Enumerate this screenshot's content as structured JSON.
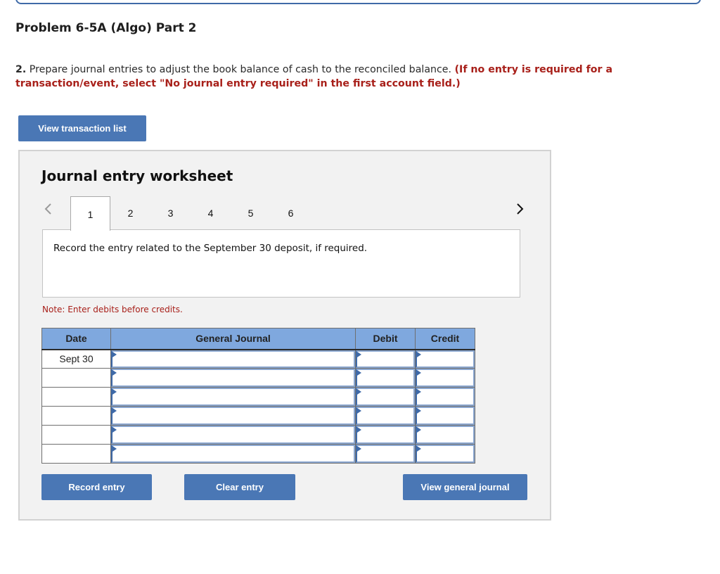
{
  "header": {
    "problem_title": "Problem 6-5A (Algo) Part 2",
    "instruction_number": "2.",
    "instruction_text": " Prepare journal entries to adjust the book balance of cash to the reconciled balance. ",
    "instruction_warning": "(If no entry is required for a transaction/event, select \"No journal entry required\" in the first account field.)"
  },
  "buttons": {
    "view_transaction_list": "View transaction list",
    "record_entry": "Record entry",
    "clear_entry": "Clear entry",
    "view_general_journal": "View general journal"
  },
  "worksheet": {
    "title": "Journal entry worksheet",
    "nav": {
      "prev_icon": "chevron-left-icon",
      "next_icon": "chevron-right-icon"
    },
    "tabs": [
      {
        "label": "1",
        "active": true
      },
      {
        "label": "2",
        "active": false
      },
      {
        "label": "3",
        "active": false
      },
      {
        "label": "4",
        "active": false
      },
      {
        "label": "5",
        "active": false
      },
      {
        "label": "6",
        "active": false
      }
    ],
    "prompt": "Record the entry related to the September 30 deposit, if required.",
    "note": "Note: Enter debits before credits.",
    "table": {
      "headers": {
        "date": "Date",
        "general_journal": "General Journal",
        "debit": "Debit",
        "credit": "Credit"
      },
      "rows": [
        {
          "date": "Sept 30",
          "account": "",
          "debit": "",
          "credit": ""
        },
        {
          "date": "",
          "account": "",
          "debit": "",
          "credit": ""
        },
        {
          "date": "",
          "account": "",
          "debit": "",
          "credit": ""
        },
        {
          "date": "",
          "account": "",
          "debit": "",
          "credit": ""
        },
        {
          "date": "",
          "account": "",
          "debit": "",
          "credit": ""
        },
        {
          "date": "",
          "account": "",
          "debit": "",
          "credit": ""
        }
      ]
    }
  },
  "colors": {
    "button_blue": "#4a77b5",
    "header_blue": "#7fa8de",
    "warning_red": "#a8201a",
    "panel_gray": "#f2f2f2"
  }
}
